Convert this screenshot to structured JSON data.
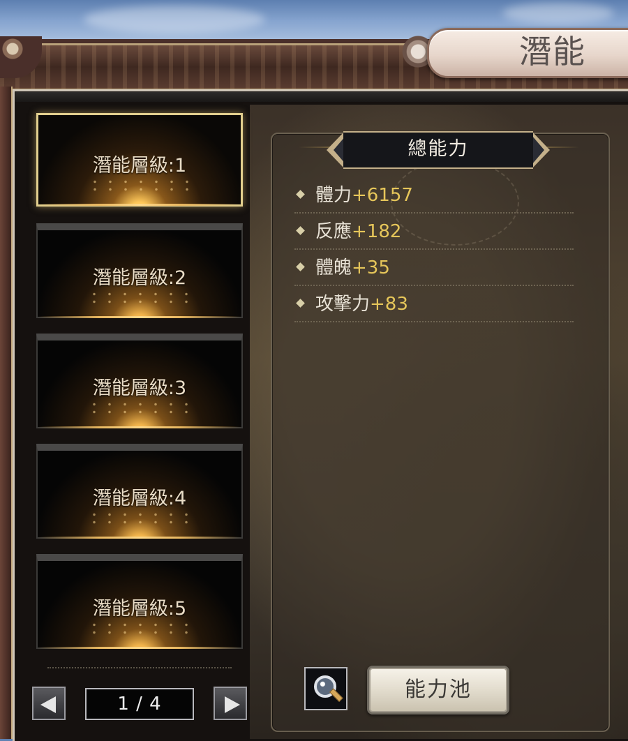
{
  "window": {
    "title": "潛能"
  },
  "tiers": {
    "items": [
      {
        "label": "潛能層級:1",
        "selected": true
      },
      {
        "label": "潛能層級:2",
        "selected": false
      },
      {
        "label": "潛能層級:3",
        "selected": false
      },
      {
        "label": "潛能層級:4",
        "selected": false
      },
      {
        "label": "潛能層級:5",
        "selected": false
      }
    ]
  },
  "pager": {
    "text": "1 / 4",
    "prev_icon": "left-triangle-icon",
    "next_icon": "right-triangle-icon"
  },
  "stats": {
    "header": "總能力",
    "rows": [
      {
        "name": "體力",
        "value": "+6157"
      },
      {
        "name": "反應",
        "value": "+182"
      },
      {
        "name": "體魄",
        "value": "+35"
      },
      {
        "name": "攻擊力",
        "value": "+83"
      }
    ]
  },
  "actions": {
    "search_icon": "magnifier-icon",
    "pool_label": "能力池"
  },
  "colors": {
    "stat_value": "#e6c65a",
    "stat_name": "#e8e2d6",
    "selected_border": "#e2cf8e"
  }
}
